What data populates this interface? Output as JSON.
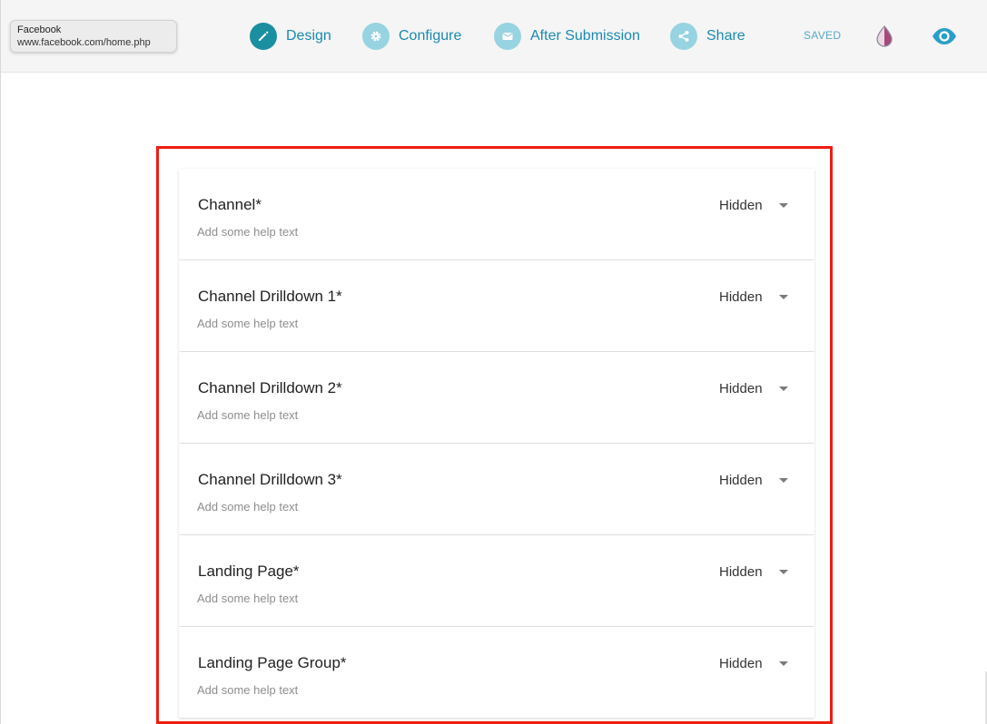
{
  "tooltip": {
    "title": "Facebook",
    "url": "www.facebook.com/home.php"
  },
  "nav": {
    "items": [
      {
        "label": "Design",
        "icon": "pencil-icon",
        "active": true
      },
      {
        "label": "Configure",
        "icon": "gear-icon",
        "active": false
      },
      {
        "label": "After Submission",
        "icon": "envelope-icon",
        "active": false
      },
      {
        "label": "Share",
        "icon": "share-icon",
        "active": false
      }
    ],
    "status": "SAVED",
    "accent_color": "#1a8ab0",
    "active_icon_color": "#1a8fa0",
    "inactive_icon_color": "#97d3e1"
  },
  "fields": [
    {
      "title": "Channel*",
      "help": "Add some help text",
      "visibility": "Hidden"
    },
    {
      "title": "Channel Drilldown 1*",
      "help": "Add some help text",
      "visibility": "Hidden"
    },
    {
      "title": "Channel Drilldown 2*",
      "help": "Add some help text",
      "visibility": "Hidden"
    },
    {
      "title": "Channel Drilldown 3*",
      "help": "Add some help text",
      "visibility": "Hidden"
    },
    {
      "title": "Landing Page*",
      "help": "Add some help text",
      "visibility": "Hidden"
    },
    {
      "title": "Landing Page Group*",
      "help": "Add some help text",
      "visibility": "Hidden"
    }
  ],
  "highlight_color": "#ee1d12"
}
